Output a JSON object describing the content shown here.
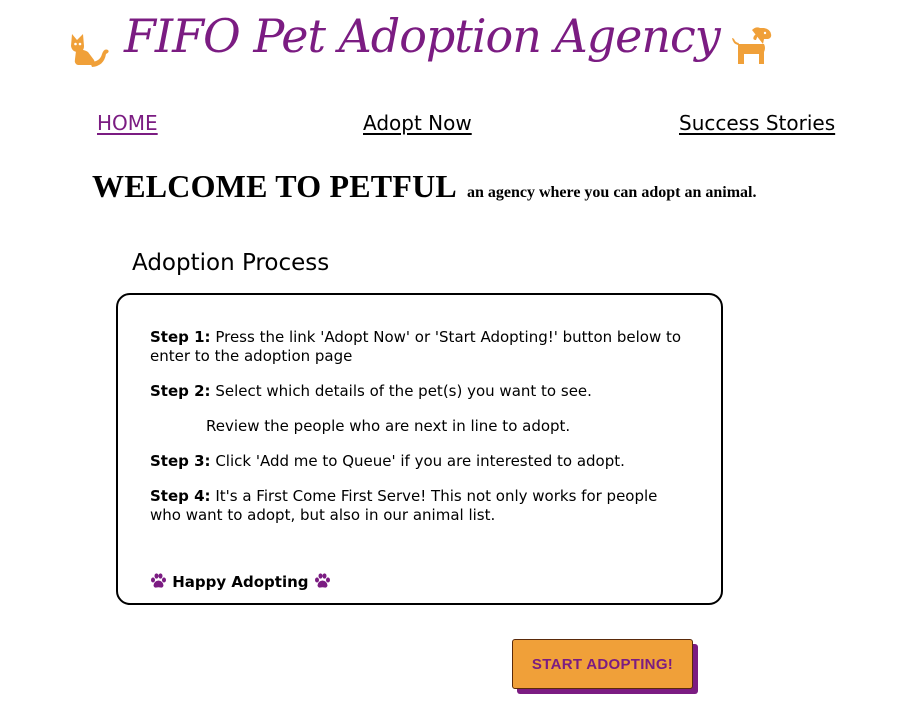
{
  "header": {
    "title": "FIFO Pet Adoption Agency",
    "left_icon": "cat-icon",
    "right_icon": "dog-icon",
    "icon_color": "#f0a039",
    "title_color": "#7b1c82"
  },
  "nav": {
    "home": "HOME",
    "adopt_now": "Adopt Now",
    "success_stories": "Success Stories",
    "active": "HOME"
  },
  "welcome": {
    "title": "WELCOME TO PETFUL",
    "subtitle": "an agency where you can adopt an animal."
  },
  "process": {
    "heading": "Adoption Process",
    "steps": [
      {
        "label": "Step 1:",
        "text": "Press the link 'Adopt Now' or 'Start Adopting!' button below to enter to the adoption page"
      },
      {
        "label": "Step 2:",
        "text": "Select which details of the pet(s) you want to see."
      },
      {
        "label": "",
        "text": "Review the people who are next in line to adopt."
      },
      {
        "label": "Step 3:",
        "text": "Click 'Add me to Queue' if you are interested to adopt."
      },
      {
        "label": "Step 4:",
        "text": "It's a First Come First Serve! This not only works for people who want to adopt, but also in our animal list."
      }
    ],
    "closing": "Happy Adopting",
    "closing_icon": "paw-icon"
  },
  "cta": {
    "label": "START ADOPTING!",
    "bg_color": "#f0a039",
    "shadow_color": "#7b1c82"
  }
}
